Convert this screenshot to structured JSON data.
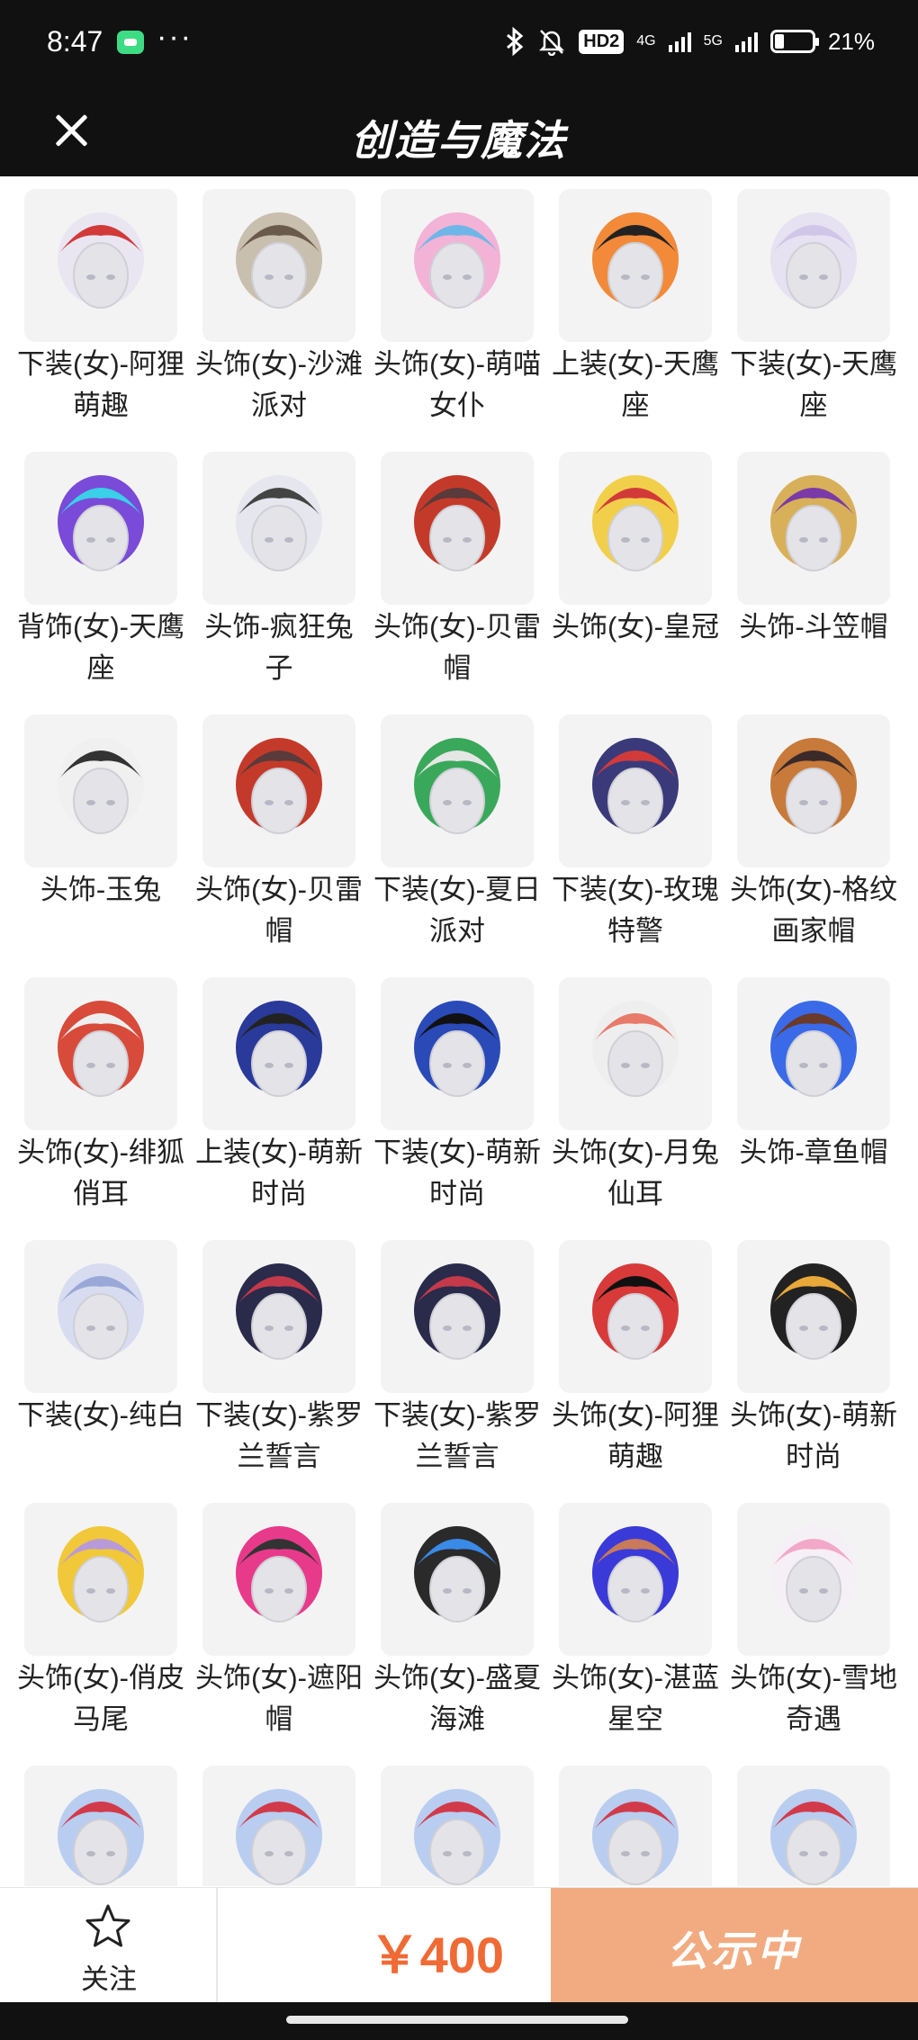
{
  "status_bar": {
    "time": "8:47",
    "more": "···",
    "hd_badge": "HD2",
    "net1": "4G",
    "net2": "5G",
    "battery_pct": "21%"
  },
  "header": {
    "title": "创造与魔法",
    "close_icon": "close-icon"
  },
  "items": [
    {
      "label": "下装(女)-阿狸萌趣"
    },
    {
      "label": "头饰(女)-沙滩派对"
    },
    {
      "label": "头饰(女)-萌喵女仆"
    },
    {
      "label": "上装(女)-天鹰座"
    },
    {
      "label": "下装(女)-天鹰座"
    },
    {
      "label": "背饰(女)-天鹰座"
    },
    {
      "label": "头饰-疯狂兔子"
    },
    {
      "label": "头饰(女)-贝雷帽"
    },
    {
      "label": "头饰(女)-皇冠"
    },
    {
      "label": "头饰-斗笠帽"
    },
    {
      "label": "头饰-玉兔"
    },
    {
      "label": "头饰(女)-贝雷帽"
    },
    {
      "label": "下装(女)-夏日派对"
    },
    {
      "label": "下装(女)-玫瑰特警"
    },
    {
      "label": "头饰(女)-格纹画家帽"
    },
    {
      "label": "头饰(女)-绯狐俏耳"
    },
    {
      "label": "上装(女)-萌新时尚"
    },
    {
      "label": "下装(女)-萌新时尚"
    },
    {
      "label": "头饰(女)-月兔仙耳"
    },
    {
      "label": "头饰-章鱼帽"
    },
    {
      "label": "下装(女)-纯白"
    },
    {
      "label": "下装(女)-紫罗兰誓言"
    },
    {
      "label": "下装(女)-紫罗兰誓言"
    },
    {
      "label": "头饰(女)-阿狸萌趣"
    },
    {
      "label": "头饰(女)-萌新时尚"
    },
    {
      "label": "头饰(女)-俏皮马尾"
    },
    {
      "label": "头饰(女)-遮阳帽"
    },
    {
      "label": "头饰(女)-盛夏海滩"
    },
    {
      "label": "头饰(女)-湛蓝星空"
    },
    {
      "label": "头饰(女)-雪地奇遇"
    },
    {
      "label": ""
    },
    {
      "label": ""
    },
    {
      "label": ""
    },
    {
      "label": ""
    },
    {
      "label": ""
    }
  ],
  "bottom_bar": {
    "follow_label": "关注",
    "follow_icon": "star-icon",
    "price": "￥400",
    "status_button_label": "公示中"
  },
  "colors": {
    "header_bg": "#111111",
    "price": "#f06a35",
    "status_button_bg": "#f2ab80"
  }
}
